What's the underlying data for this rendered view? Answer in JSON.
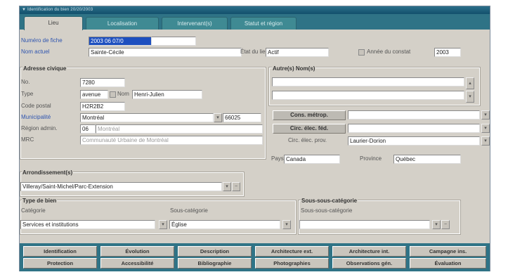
{
  "window": {
    "title": "▼ Identification du bien 20/20/2003"
  },
  "tabs": [
    {
      "label": "Lieu"
    },
    {
      "label": "Localisation"
    },
    {
      "label": "Intervenant(s)"
    },
    {
      "label": "Statut et région"
    }
  ],
  "fiche": {
    "label": "Numéro de fiche",
    "value": "2003 06 07/0"
  },
  "nom_actuel": {
    "label": "Nom actuel",
    "value": "Sainte-Cécile"
  },
  "etat": {
    "label": "État du lieu",
    "value": "Actif"
  },
  "annee": {
    "label": "Année du constat",
    "value": "2003"
  },
  "adresse": {
    "title": "Adresse civique",
    "no_label": "No.",
    "no_value": "7280",
    "type_label": "Type",
    "type_value": "avenue",
    "nom_label": "Nom",
    "nom_value": "Henri-Julien",
    "cp_label": "Code postal",
    "cp_value": "H2R2B2",
    "muni_label": "Municipalité",
    "muni_value": "Montréal",
    "muni_code": "66025",
    "region_label": "Région admin.",
    "region_code": "06",
    "region_value": "Montréal",
    "mrc_label": "MRC",
    "mrc_value": "Communauté Urbaine de Montréal"
  },
  "autres_noms": {
    "title": "Autre(s) Nom(s)"
  },
  "circ": {
    "cons_label": "Cons. métrop.",
    "dec_label": "Circ. élec. féd.",
    "prov_label": "Circ. élec. prov.",
    "prov_value": "Laurier-Dorion"
  },
  "pays": {
    "label": "Pays",
    "value": "Canada"
  },
  "province": {
    "label": "Province",
    "value": "Québec"
  },
  "arrond": {
    "title": "Arrondissement(s)",
    "value": "Villeray/Saint-Michel/Parc-Extension"
  },
  "type_bien": {
    "title": "Type de bien",
    "cat_label": "Catégorie",
    "cat_value": "Services et institutions",
    "sous_label": "Sous-catégorie",
    "sous_value": "Église"
  },
  "sous_sous": {
    "title": "Sous-sous-catégorie",
    "label": "Sous-sous-catégorie",
    "value": ""
  },
  "bottom_buttons_row1": [
    "Identification",
    "Évolution",
    "Description",
    "Architecture ext.",
    "Architecture int.",
    "Campagne ins."
  ],
  "bottom_buttons_row2": [
    "Protection",
    "Accessibilité",
    "Bibliographie",
    "Photographies",
    "Observations gén.",
    "Évaluation"
  ],
  "colors": {
    "teal": "#2f7386",
    "panel": "#d4d0c8",
    "selection": "#1d4fbf"
  },
  "icons": {
    "dropdown": "chevron-down-icon",
    "scroll_up": "arrow-up-icon",
    "scroll_down": "arrow-down-icon"
  }
}
